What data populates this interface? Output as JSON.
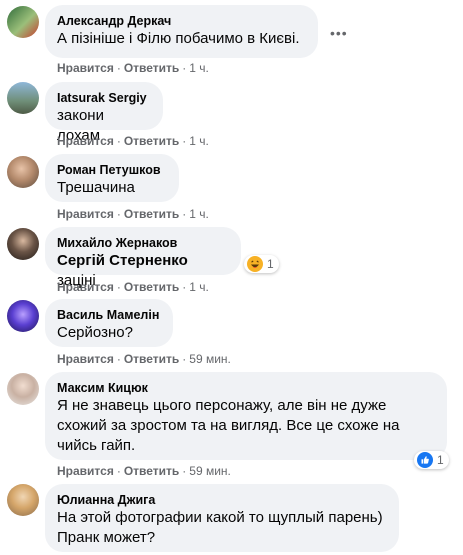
{
  "comments": [
    {
      "author": "Александр Деркач",
      "text": "А пізініше і Філю побачимо в Києві.",
      "actions": {
        "like": "Нравится",
        "reply": "Ответить",
        "time": "1 ч."
      }
    },
    {
      "author": "Iatsurak Sergiy",
      "text": "закони лохам",
      "actions": {
        "like": "Нравится",
        "reply": "Ответить",
        "time": "1 ч."
      }
    },
    {
      "author": "Роман Петушков",
      "text": "Трешачина",
      "actions": {
        "like": "Нравится",
        "reply": "Ответить",
        "time": "1 ч."
      }
    },
    {
      "author": "Михайло Жернаков",
      "mention": "Сергій Стерненко",
      "text": "зацінi",
      "reaction_count": "1",
      "reaction_icon": "haha-icon",
      "actions": {
        "like": "Нравится",
        "reply": "Ответить",
        "time": "1 ч."
      }
    },
    {
      "author": "Василь Мамелін",
      "text": "Серйозно?",
      "actions": {
        "like": "Нравится",
        "reply": "Ответить",
        "time": "59 мин."
      }
    },
    {
      "author": "Максим Кицюк",
      "text_lines": [
        "Я не знавець цього персонажу, але він не дуже",
        "схожий за зростом та на вигляд. Все це схоже на",
        "чийсь гайп."
      ],
      "reaction_count": "1",
      "reaction_icon": "like-icon",
      "actions": {
        "like": "Нравится",
        "reply": "Ответить",
        "time": "59 мин."
      }
    },
    {
      "author": "Юлианна Джига",
      "text_lines": [
        "На этой фотографии какой то щуплый парень)",
        "Пранк может?"
      ]
    }
  ],
  "more_icon": "ellipsis-icon",
  "colors": {
    "bubble": "#f0f2f5",
    "meta": "#65676b",
    "like_blue": "#1877f2",
    "haha_yellow": "#f7b125"
  }
}
